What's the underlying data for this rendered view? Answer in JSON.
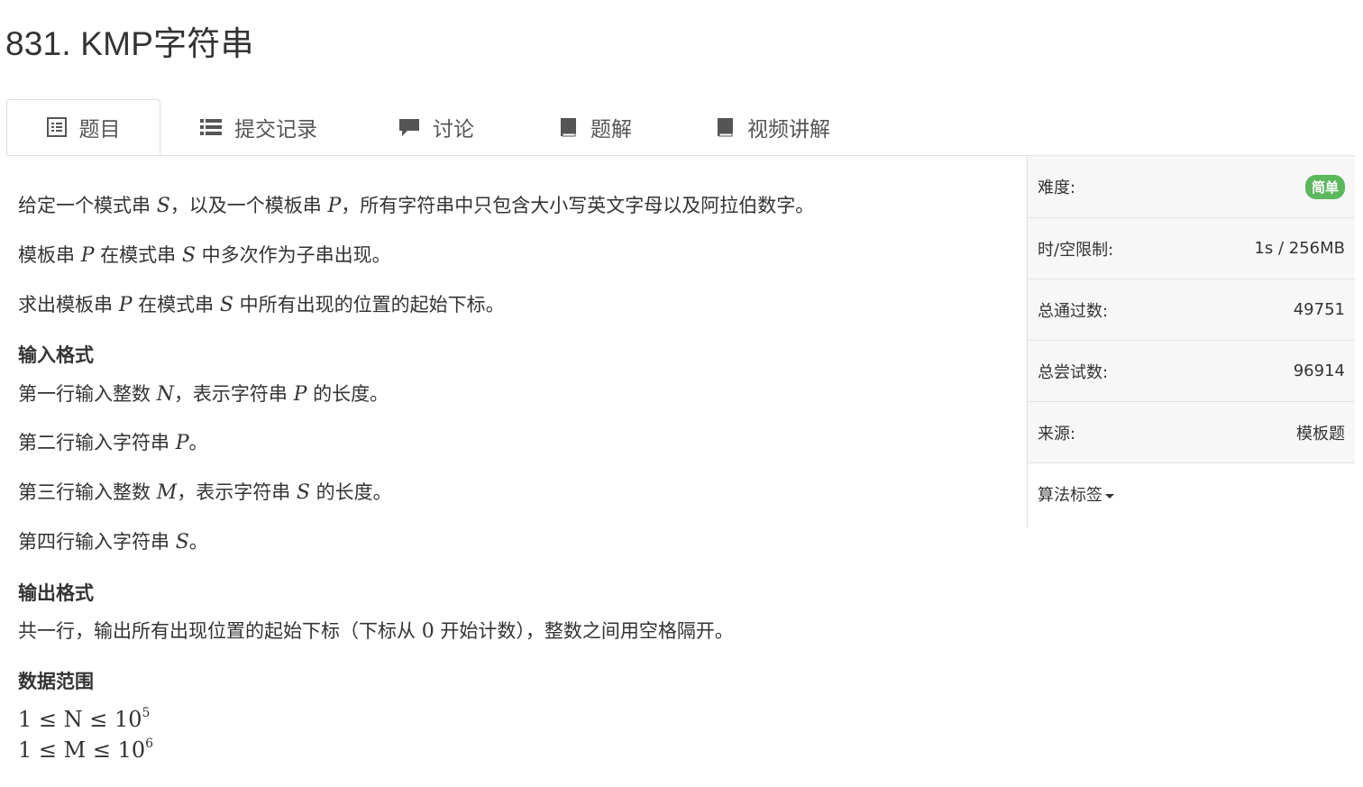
{
  "problem": {
    "title": "831. KMP字符串"
  },
  "tabs": [
    {
      "label": "题目",
      "icon": "list-alt-icon"
    },
    {
      "label": "提交记录",
      "icon": "list-icon"
    },
    {
      "label": "讨论",
      "icon": "comment-icon"
    },
    {
      "label": "题解",
      "icon": "book-icon"
    },
    {
      "label": "视频讲解",
      "icon": "book-icon"
    }
  ],
  "statement": {
    "p1": {
      "a": "给定一个模式串 ",
      "S": "S",
      "b": "，以及一个模板串 ",
      "P": "P",
      "c": "，所有字符串中只包含大小写英文字母以及阿拉伯数字。"
    },
    "p2": {
      "a": "模板串 ",
      "P": "P",
      "b": " 在模式串 ",
      "S": "S",
      "c": " 中多次作为子串出现。"
    },
    "p3": {
      "a": "求出模板串 ",
      "P": "P",
      "b": " 在模式串 ",
      "S": "S",
      "c": " 中所有出现的位置的起始下标。"
    }
  },
  "input_format": {
    "heading": "输入格式",
    "l1": {
      "a": "第一行输入整数 ",
      "N": "N",
      "b": "，表示字符串 ",
      "P": "P",
      "c": " 的长度。"
    },
    "l2": {
      "a": "第二行输入字符串 ",
      "P": "P",
      "b": "。"
    },
    "l3": {
      "a": "第三行输入整数 ",
      "M": "M",
      "b": "，表示字符串 ",
      "S": "S",
      "c": " 的长度。"
    },
    "l4": {
      "a": "第四行输入字符串 ",
      "S": "S",
      "b": "。"
    }
  },
  "output_format": {
    "heading": "输出格式",
    "l1": {
      "a": "共一行，输出所有出现位置的起始下标（下标从 ",
      "zero": "0",
      "b": " 开始计数），整数之间用空格隔开。"
    }
  },
  "data_range": {
    "heading": "数据范围",
    "r1": {
      "expr": "1 ≤ N ≤ 10",
      "exp": "5"
    },
    "r2": {
      "expr": "1 ≤ M ≤ 10",
      "exp": "6"
    }
  },
  "sidebar": {
    "difficulty": {
      "label": "难度:",
      "value": "简单",
      "color": "#5cb85c"
    },
    "limits": {
      "label": "时/空限制:",
      "value": "1s / 256MB"
    },
    "accepted": {
      "label": "总通过数:",
      "value": "49751"
    },
    "attempts": {
      "label": "总尝试数:",
      "value": "96914"
    },
    "source": {
      "label": "来源:",
      "value": "模板题"
    },
    "tags": {
      "label": "算法标签"
    }
  }
}
